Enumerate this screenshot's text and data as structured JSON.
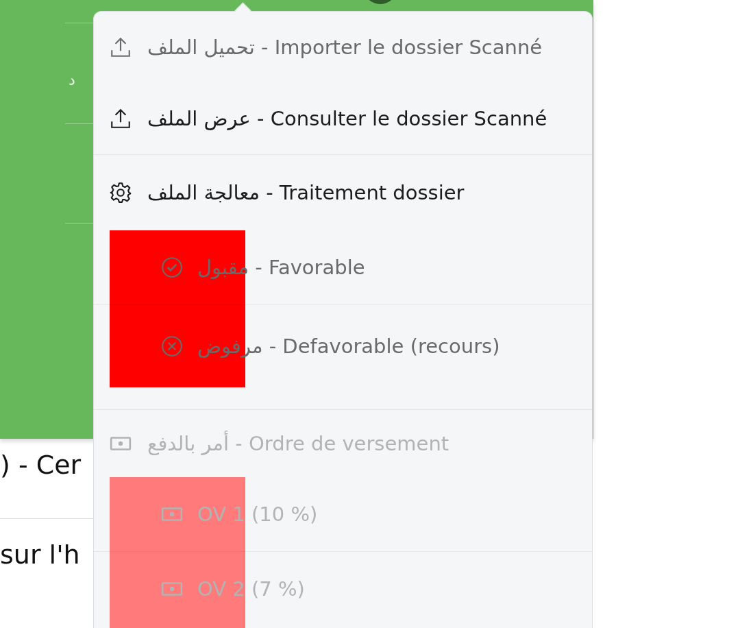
{
  "background": {
    "sidebar_glyph": "د",
    "lines": [
      ") - Cer",
      "sur l'h"
    ]
  },
  "menu": {
    "sections": [
      {
        "items": [
          {
            "kind": "upload",
            "muted": true,
            "disabled": false,
            "label": "تحميل الملف - Importer le dossier Scanné"
          },
          {
            "kind": "upload",
            "muted": false,
            "disabled": false,
            "label": "عرض الملف - Consulter le dossier Scanné"
          }
        ]
      },
      {
        "items": [
          {
            "kind": "gear",
            "muted": false,
            "disabled": false,
            "label": "معالجة الملف - Traitement dossier"
          }
        ],
        "sub": {
          "color": "#ff0000",
          "items": [
            {
              "kind": "check",
              "muted": true,
              "disabled": false,
              "label": "مقبول - Favorable"
            },
            {
              "kind": "cross",
              "muted": true,
              "disabled": false,
              "label": "مرفوض - Defavorable (recours)"
            }
          ]
        }
      },
      {
        "items": [
          {
            "kind": "money",
            "muted": false,
            "disabled": true,
            "label": "أمر بالدفع - Ordre de versement"
          }
        ],
        "sub": {
          "color": "#ff7b7b",
          "items": [
            {
              "kind": "money",
              "muted": false,
              "disabled": true,
              "label": "OV 1 (10 %)"
            },
            {
              "kind": "money",
              "muted": false,
              "disabled": true,
              "label": "OV 2 (7 %)"
            }
          ]
        }
      }
    ]
  }
}
